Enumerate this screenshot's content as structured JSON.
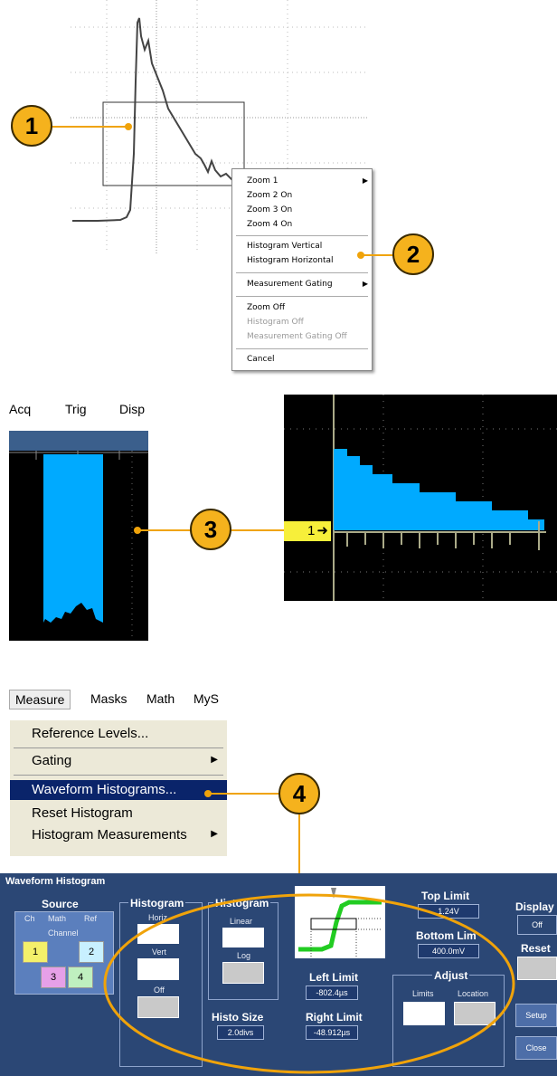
{
  "callouts": [
    "1",
    "2",
    "3",
    "4"
  ],
  "context_menu": {
    "items": [
      {
        "label": "Zoom 1",
        "disabled": false,
        "submenu": true
      },
      {
        "label": "Zoom 2 On",
        "disabled": false,
        "submenu": false
      },
      {
        "label": "Zoom 3 On",
        "disabled": false,
        "submenu": false
      },
      {
        "label": "Zoom 4 On",
        "disabled": false,
        "submenu": false
      },
      {
        "label": "Histogram Vertical",
        "disabled": false,
        "submenu": false
      },
      {
        "label": "Histogram Horizontal",
        "disabled": false,
        "submenu": false
      },
      {
        "label": "Measurement Gating",
        "disabled": false,
        "submenu": true
      },
      {
        "label": "Zoom Off",
        "disabled": false,
        "submenu": false
      },
      {
        "label": "Histogram Off",
        "disabled": true,
        "submenu": false
      },
      {
        "label": "Measurement Gating Off",
        "disabled": true,
        "submenu": false
      },
      {
        "label": "Cancel",
        "disabled": false,
        "submenu": false
      }
    ]
  },
  "scope_menubar": {
    "acq": "Acq",
    "trig": "Trig",
    "disp": "Disp"
  },
  "ref_marker": "1",
  "measure_menubar": {
    "measure": "Measure",
    "masks": "Masks",
    "math": "Math",
    "my": "MyS"
  },
  "measure_menu": {
    "reference_levels": "Reference Levels...",
    "gating": "Gating",
    "waveform_histograms": "Waveform Histograms...",
    "reset_histogram": "Reset Histogram",
    "histogram_measurements": "Histogram Measurements"
  },
  "panel": {
    "title": "Waveform Histogram",
    "source": "Source",
    "tab_ch": "Ch",
    "tab_math": "Math",
    "tab_ref": "Ref",
    "channel": "Channel",
    "ch1": "1",
    "ch2": "2",
    "ch3": "3",
    "ch4": "4",
    "histogram_group": "Histogram",
    "horiz": "Horiz",
    "vert": "Vert",
    "off": "Off",
    "scale_group": "Histogram",
    "linear": "Linear",
    "log": "Log",
    "histo_size_label": "Histo Size",
    "histo_size_value": "2.0divs",
    "left_limit_label": "Left Limit",
    "left_limit_value": "-802.4µs",
    "right_limit_label": "Right Limit",
    "right_limit_value": "-48.912µs",
    "top_limit_label": "Top Limit",
    "top_limit_value": "1.24V",
    "bottom_limit_label": "Bottom Lim",
    "bottom_limit_value": "400.0mV",
    "adjust_group": "Adjust",
    "limits": "Limits",
    "location": "Location",
    "display_label": "Display",
    "display_value": "Off",
    "reset": "Reset",
    "setup": "Setup",
    "close": "Close"
  },
  "colors": {
    "callout": "#f5b21d",
    "histogram": "#00aaff",
    "panel": "#2b4775",
    "selected_menu": "#0a246a"
  }
}
